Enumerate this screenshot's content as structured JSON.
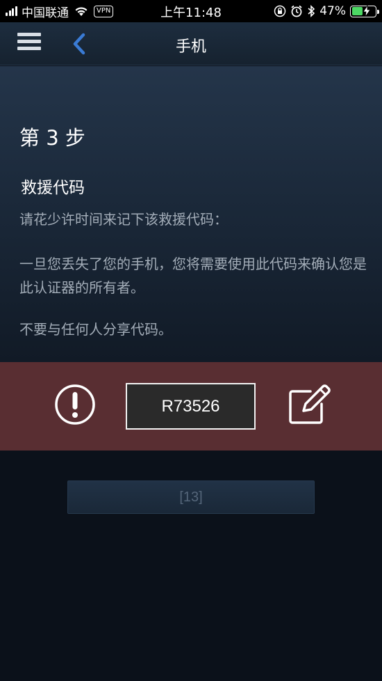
{
  "status_bar": {
    "carrier": "中国联通",
    "vpn": "VPN",
    "time": "上午11:48",
    "battery_percent": "47%",
    "battery_level": 0.47,
    "signal_bars": 4
  },
  "nav": {
    "title": "手机",
    "menu_icon": "hamburger-menu-icon",
    "back_icon": "chevron-left-icon"
  },
  "content": {
    "step_title": "第 3 步",
    "section_title": "救援代码",
    "paragraph_1": "请花少许时间来记下该救援代码：",
    "paragraph_2": "一旦您丢失了您的手机，您将需要使用此代码来确认您是此认证器的所有者。",
    "paragraph_3": "不要与任何人分享代码。"
  },
  "recovery": {
    "code": "R73526",
    "warning_icon": "exclamation-circle-icon",
    "edit_icon": "edit-note-icon"
  },
  "button": {
    "label": "[13]"
  },
  "colors": {
    "accent_blue": "#3a7bd5",
    "band_red": "#592e32",
    "text_muted": "#a3adb8",
    "battery_green": "#4cd964"
  }
}
